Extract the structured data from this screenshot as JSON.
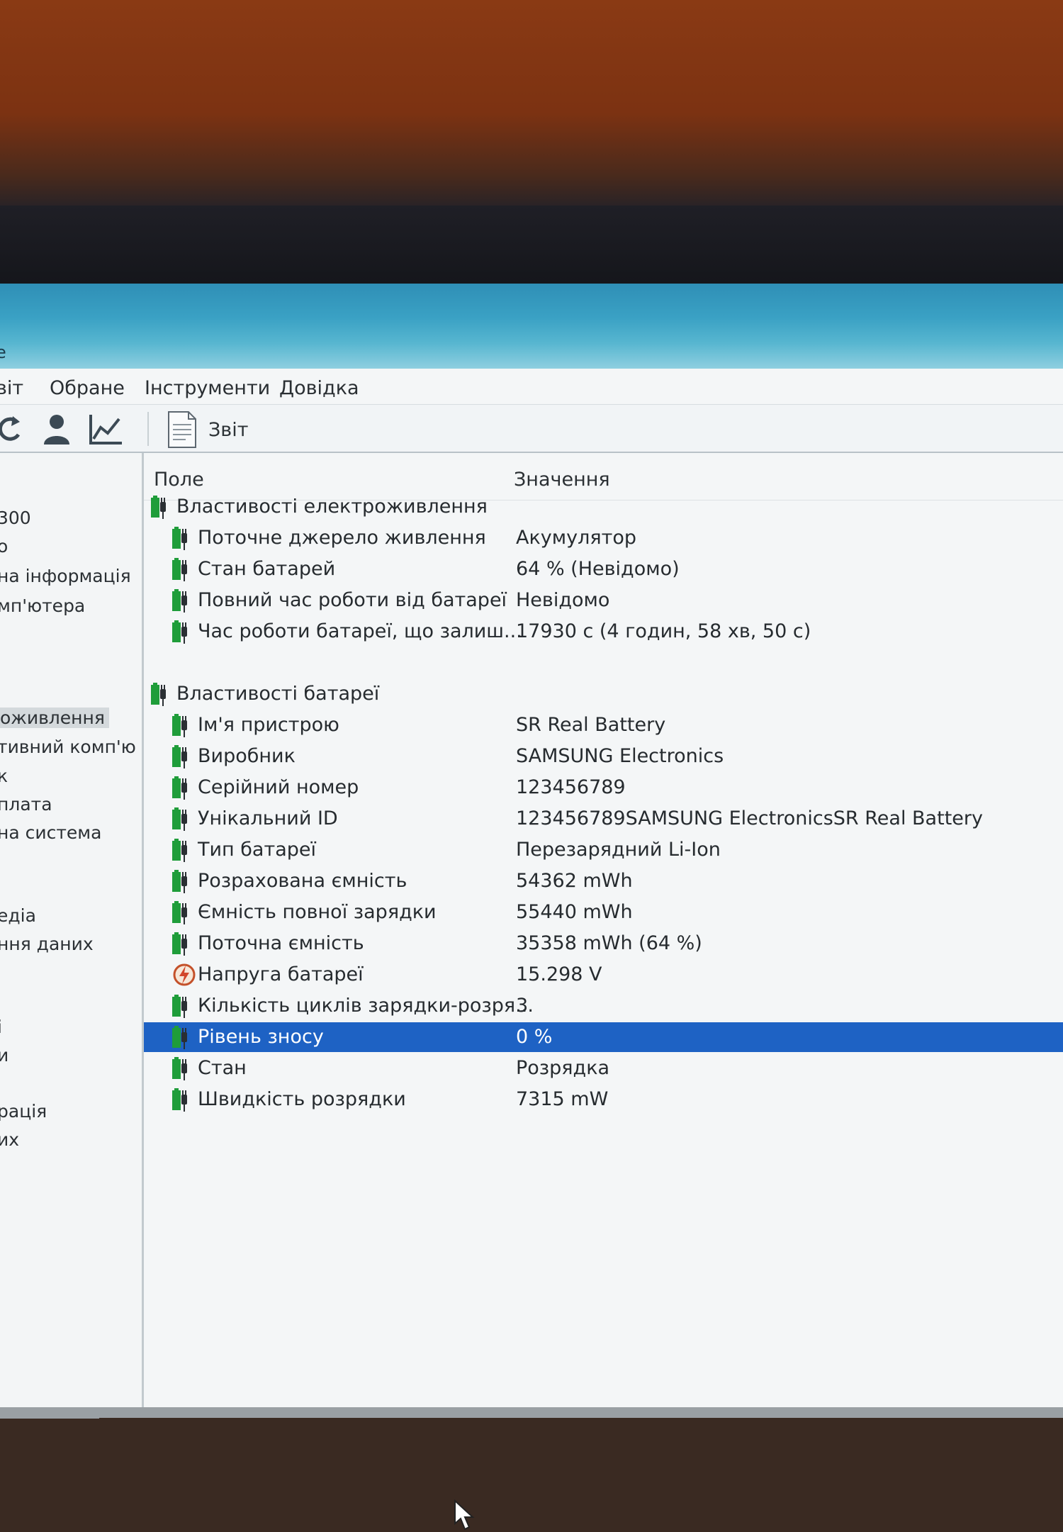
{
  "window": {
    "title_fragment": "е"
  },
  "menu": [
    "віт",
    "Обране",
    "Інструменти",
    "Довідка"
  ],
  "toolbar": {
    "report_label": "Звіт"
  },
  "sidebar": {
    "items": [
      {
        "label": "300",
        "selected": false
      },
      {
        "label": "о",
        "selected": false
      },
      {
        "label": "на інформація",
        "selected": false
      },
      {
        "label": "мп'ютера",
        "selected": false
      },
      {
        "label": "оживлення",
        "selected": true
      },
      {
        "label": "тивний комп'ю",
        "selected": false
      },
      {
        "label": "к",
        "selected": false
      },
      {
        "label": "плата",
        "selected": false
      },
      {
        "label": "на система",
        "selected": false
      },
      {
        "label": "едіа",
        "selected": false
      },
      {
        "label": "ння даних",
        "selected": false
      },
      {
        "label": "і",
        "selected": false
      },
      {
        "label": "и",
        "selected": false
      },
      {
        "label": "рація",
        "selected": false
      },
      {
        "label": "их",
        "selected": false
      }
    ]
  },
  "table": {
    "columns": {
      "field": "Поле",
      "value": "Значення"
    },
    "rows": [
      {
        "field": "Властивості електроживлення",
        "value": "",
        "level": 0,
        "icon": "battery-plug-icon"
      },
      {
        "field": "Поточне джерело живлення",
        "value": "Акумулятор",
        "level": 1,
        "icon": "battery-plug-icon"
      },
      {
        "field": "Стан батарей",
        "value": "64 % (Невідомо)",
        "level": 1,
        "icon": "battery-plug-icon"
      },
      {
        "field": "Повний час роботи від батареї",
        "value": "Невідомо",
        "level": 1,
        "icon": "battery-plug-icon"
      },
      {
        "field": "Час роботи батареї, що залиш...",
        "value": "17930 с (4 годин, 58 хв, 50 с)",
        "level": 1,
        "icon": "battery-plug-icon"
      },
      {
        "field": "Властивості батареї",
        "value": "",
        "level": 0,
        "icon": "battery-plug-icon"
      },
      {
        "field": "Ім'я пристрою",
        "value": "SR Real Battery",
        "level": 1,
        "icon": "battery-plug-icon"
      },
      {
        "field": "Виробник",
        "value": "SAMSUNG Electronics",
        "level": 1,
        "icon": "battery-plug-icon"
      },
      {
        "field": "Серійний номер",
        "value": "123456789",
        "level": 1,
        "icon": "battery-plug-icon"
      },
      {
        "field": "Унікальний ID",
        "value": "123456789SAMSUNG ElectronicsSR Real Battery",
        "level": 1,
        "icon": "battery-plug-icon"
      },
      {
        "field": "Тип батареї",
        "value": "Перезарядний Li-Ion",
        "level": 1,
        "icon": "battery-plug-icon"
      },
      {
        "field": "Розрахована ємність",
        "value": "54362 mWh",
        "level": 1,
        "icon": "battery-plug-icon"
      },
      {
        "field": "Ємність повної зарядки",
        "value": "55440 mWh",
        "level": 1,
        "icon": "battery-plug-icon"
      },
      {
        "field": "Поточна ємність",
        "value": "35358 mWh  (64 %)",
        "level": 1,
        "icon": "battery-plug-icon"
      },
      {
        "field": "Напруга батареї",
        "value": "15.298 V",
        "level": 1,
        "icon": "voltage-icon"
      },
      {
        "field": "Кількість циклів зарядки-розря...",
        "value": "3",
        "level": 1,
        "icon": "battery-plug-icon"
      },
      {
        "field": "Рівень зносу",
        "value": "0 %",
        "level": 1,
        "icon": "battery-plug-icon",
        "selected": true
      },
      {
        "field": "Стан",
        "value": "Розрядка",
        "level": 1,
        "icon": "battery-plug-icon"
      },
      {
        "field": "Швидкість розрядки",
        "value": "7315 mW",
        "level": 1,
        "icon": "battery-plug-icon"
      }
    ]
  },
  "colors": {
    "titlebar": "#3aa1c4",
    "selection": "#1e62c4",
    "battery_green": "#1f9d3a"
  }
}
